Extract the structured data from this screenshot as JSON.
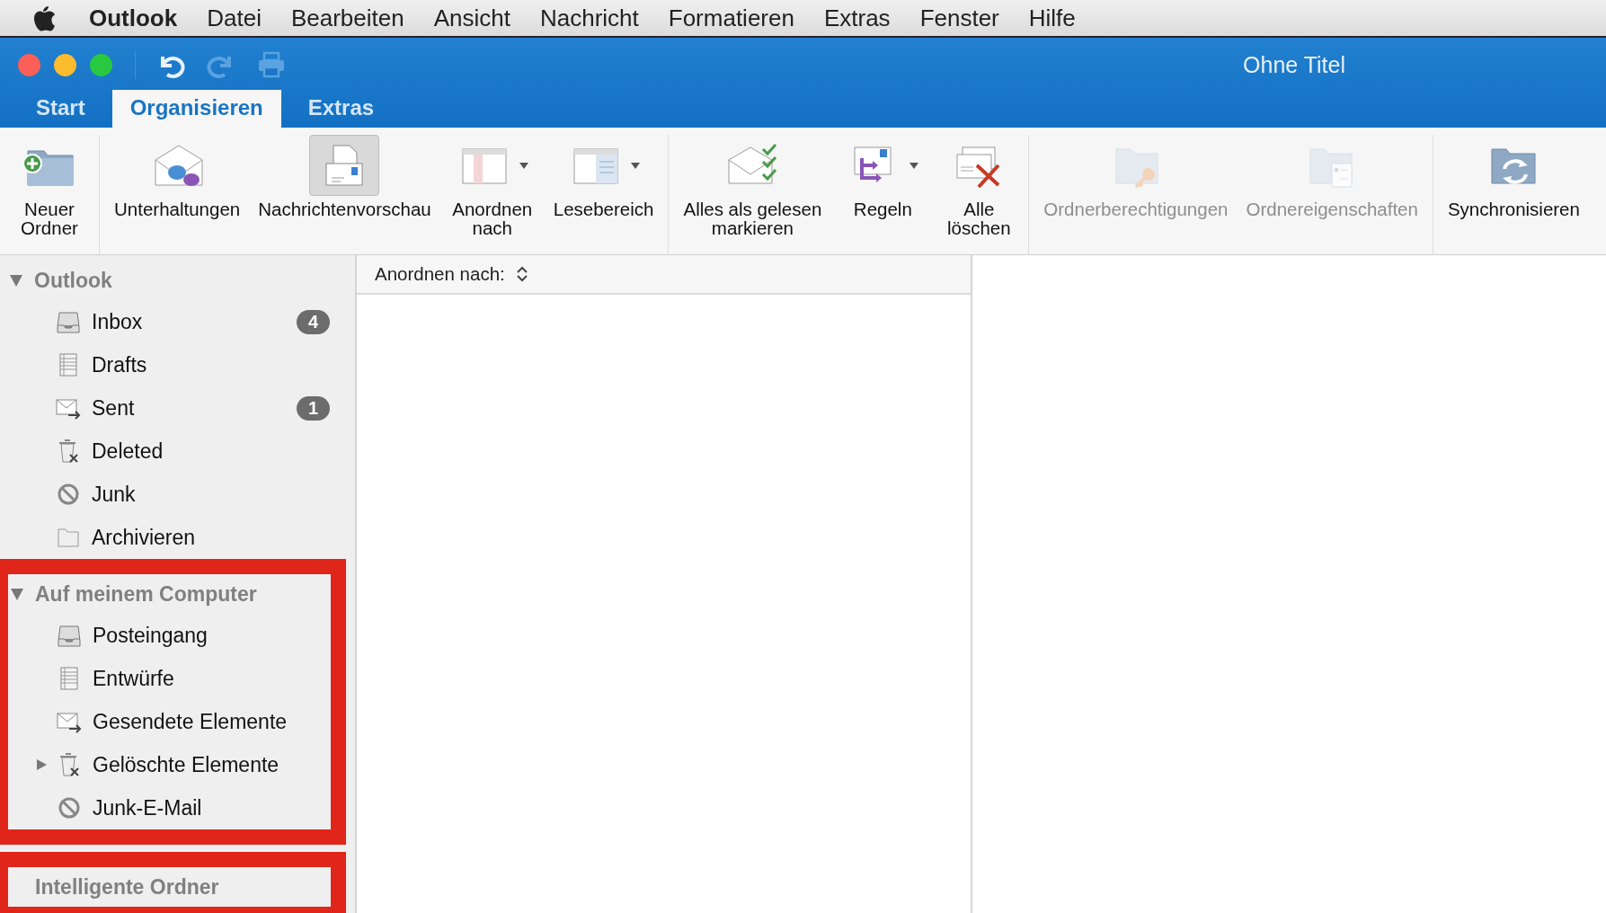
{
  "menu_bar": {
    "app_name": "Outlook",
    "items": [
      "Datei",
      "Bearbeiten",
      "Ansicht",
      "Nachricht",
      "Formatieren",
      "Extras",
      "Fenster",
      "Hilfe"
    ]
  },
  "window": {
    "title": "Ohne Titel"
  },
  "quick_access": [
    {
      "disabled": false
    },
    {
      "disabled": true
    },
    {
      "disabled": true
    }
  ],
  "tabs": [
    {
      "label": "Start",
      "selected": false
    },
    {
      "label": "Organisieren",
      "selected": true
    },
    {
      "label": "Extras",
      "selected": false
    }
  ],
  "ribbon": {
    "groups": [
      {
        "buttons": [
          {
            "label": "Neuer\nOrdner",
            "selected": false,
            "disabled": false,
            "dropdown": false
          }
        ]
      },
      {
        "buttons": [
          {
            "label": "Unterhaltungen",
            "selected": false,
            "disabled": false,
            "dropdown": false
          },
          {
            "label": "Nachrichtenvorschau",
            "selected": true,
            "disabled": false,
            "dropdown": false
          },
          {
            "label": "Anordnen\nnach",
            "selected": false,
            "disabled": false,
            "dropdown": true
          },
          {
            "label": "Lesebereich",
            "selected": false,
            "disabled": false,
            "dropdown": true
          }
        ]
      },
      {
        "buttons": [
          {
            "label": "Alles als gelesen\nmarkieren",
            "selected": false,
            "disabled": false,
            "dropdown": false
          },
          {
            "label": "Regeln",
            "selected": false,
            "disabled": false,
            "dropdown": true
          },
          {
            "label": "Alle\nlöschen",
            "selected": false,
            "disabled": false,
            "dropdown": false
          }
        ]
      },
      {
        "buttons": [
          {
            "label": "Ordnerberechtigungen",
            "selected": false,
            "disabled": true,
            "dropdown": false
          },
          {
            "label": "Ordnereigenschaften",
            "selected": false,
            "disabled": true,
            "dropdown": false
          }
        ]
      },
      {
        "buttons": [
          {
            "label": "Synchronisieren",
            "selected": false,
            "disabled": false,
            "dropdown": false
          }
        ]
      }
    ]
  },
  "sidebar": {
    "sections": [
      {
        "label": "Outlook",
        "expanded": true,
        "highlighted": false,
        "folders": [
          {
            "label": "Inbox",
            "badge": "4"
          },
          {
            "label": "Drafts"
          },
          {
            "label": "Sent",
            "badge": "1"
          },
          {
            "label": "Deleted"
          },
          {
            "label": "Junk"
          },
          {
            "label": "Archivieren"
          }
        ]
      },
      {
        "label": "Auf meinem Computer",
        "expanded": true,
        "highlighted": true,
        "folders": [
          {
            "label": "Posteingang"
          },
          {
            "label": "Entwürfe"
          },
          {
            "label": "Gesendete Elemente"
          },
          {
            "label": "Gelöschte Elemente",
            "expanded": false
          },
          {
            "label": "Junk-E-Mail"
          }
        ]
      },
      {
        "label": "Intelligente Ordner",
        "highlighted": true
      }
    ]
  },
  "message_list": {
    "sort_label": "Anordnen nach:"
  }
}
